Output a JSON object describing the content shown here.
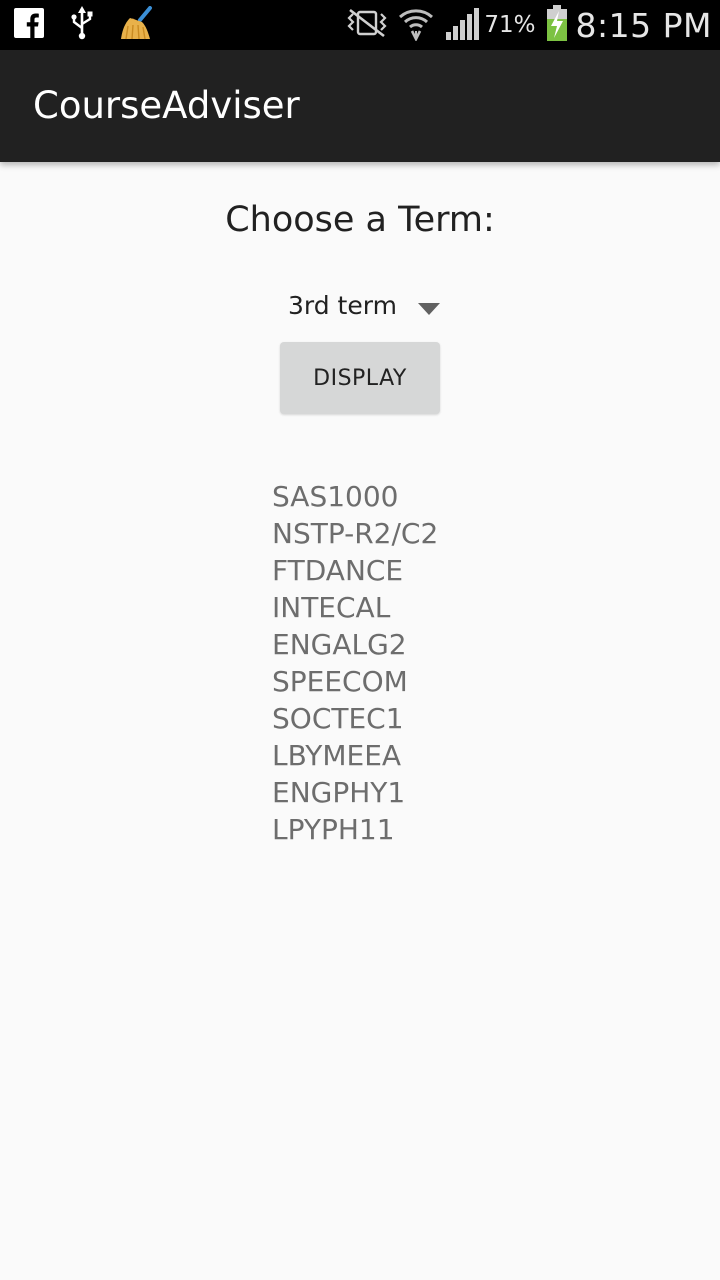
{
  "status_bar": {
    "left_icons": [
      "facebook-icon",
      "usb-icon",
      "broom-icon"
    ],
    "right_icons": [
      "mute-vibrate-icon",
      "wifi-icon",
      "signal-icon",
      "battery-charging-icon"
    ],
    "battery_percent": "71%",
    "time": "8:15 PM",
    "colors": {
      "background": "#000000",
      "battery_green": "#7cc242"
    }
  },
  "app_bar": {
    "title": "CourseAdviser",
    "background": "#212121"
  },
  "main": {
    "prompt": "Choose a Term:",
    "term_spinner": {
      "selected": "3rd term",
      "icon": "dropdown-arrow-icon"
    },
    "display_button": {
      "label": "DISPLAY",
      "background": "#d6d7d7"
    },
    "courses": [
      "SAS1000",
      "NSTP-R2/C2",
      "FTDANCE",
      "INTECAL",
      "ENGALG2",
      "SPEECOM",
      "SOCTEC1",
      "LBYMEEA",
      "ENGPHY1",
      "LPYPH11"
    ]
  }
}
